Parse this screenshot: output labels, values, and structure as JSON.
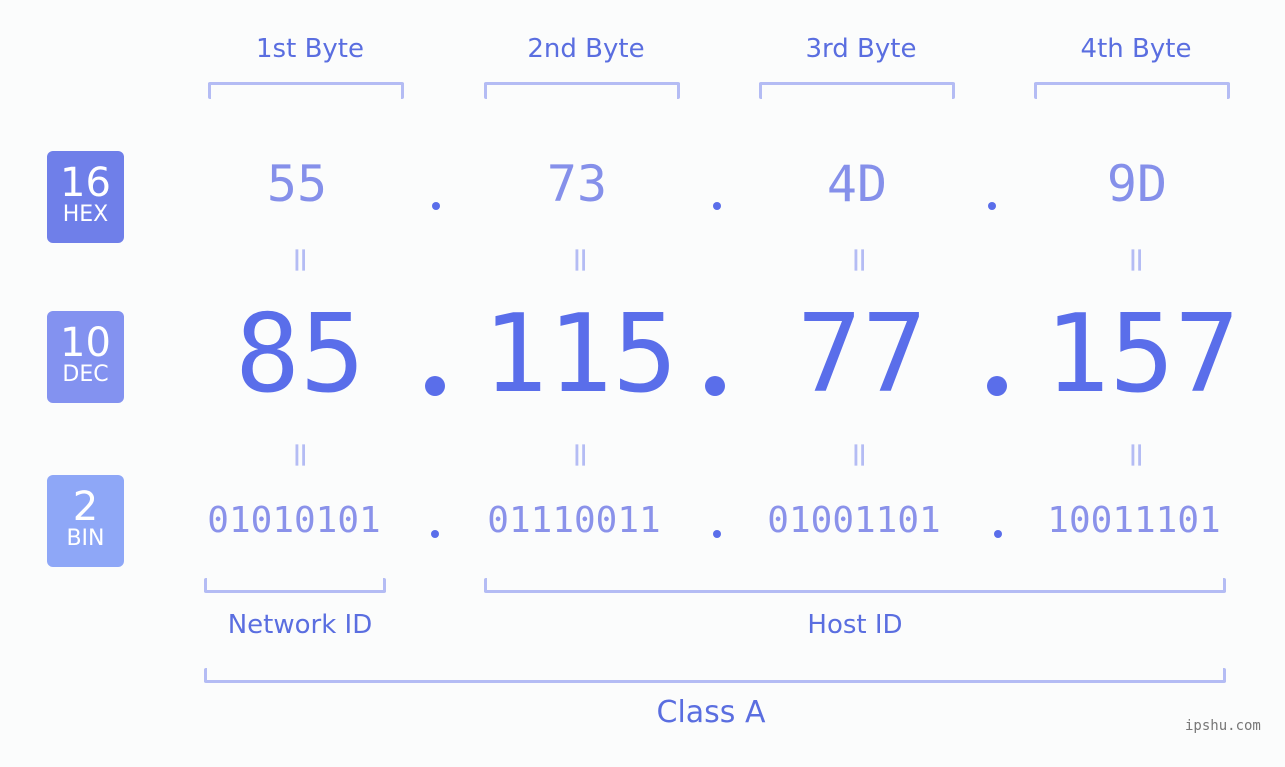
{
  "bytes": [
    {
      "label": "1st Byte",
      "hex": "55",
      "dec": "85",
      "bin": "01010101"
    },
    {
      "label": "2nd Byte",
      "hex": "73",
      "dec": "115",
      "bin": "01110011"
    },
    {
      "label": "3rd Byte",
      "hex": "4D",
      "dec": "77",
      "bin": "01001101"
    },
    {
      "label": "4th Byte",
      "hex": "9D",
      "dec": "157",
      "bin": "10011101"
    }
  ],
  "badges": {
    "hex": {
      "num": "16",
      "label": "HEX",
      "color": "#6f7fe9"
    },
    "dec": {
      "num": "10",
      "label": "DEC",
      "color": "#8392f0"
    },
    "bin": {
      "num": "2",
      "label": "BIN",
      "color": "#8ea7f7"
    }
  },
  "separator": ".",
  "equals": "=",
  "network_id_label": "Network ID",
  "host_id_label": "Host ID",
  "class_label": "Class A",
  "watermark": "ipshu.com"
}
